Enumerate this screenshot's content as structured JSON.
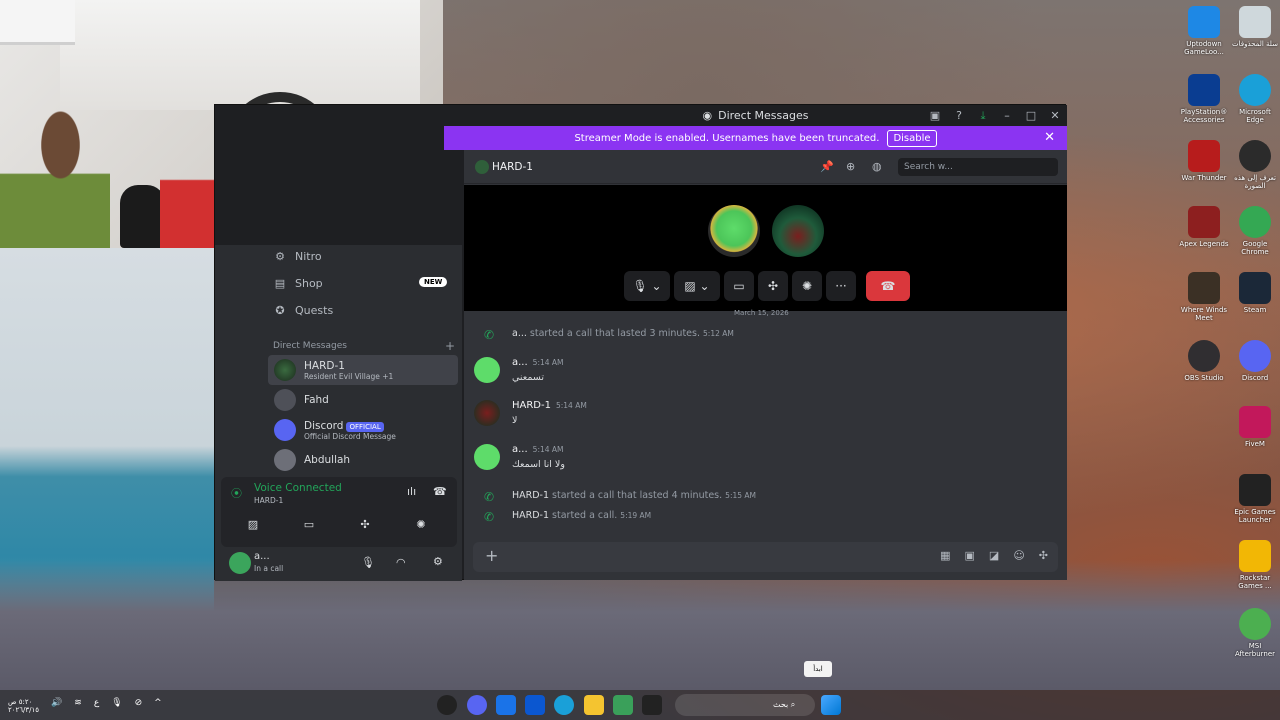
{
  "window": {
    "title": "Direct Messages",
    "banner_text": "Streamer Mode is enabled. Usernames have been truncated.",
    "banner_button": "Disable"
  },
  "sidebar": {
    "nav": [
      {
        "label": "Nitro",
        "icon": "nitro-icon"
      },
      {
        "label": "Shop",
        "icon": "shop-icon",
        "badge": "NEW"
      },
      {
        "label": "Quests",
        "icon": "quests-icon"
      }
    ],
    "dm_header": "Direct Messages",
    "dms": [
      {
        "name": "HARD-1",
        "sub": "Resident Evil Village +1"
      },
      {
        "name": "Fahd",
        "sub": ""
      },
      {
        "name": "Discord",
        "badge": "OFFICIAL",
        "sub": "Official Discord Message"
      },
      {
        "name": "Abdullah",
        "sub": ""
      }
    ]
  },
  "voice": {
    "status": "Voice Connected",
    "channel": "HARD-1"
  },
  "user": {
    "name": "a...",
    "status": "In a call"
  },
  "chat": {
    "header_name": "HARD-1",
    "search_placeholder": "Search w...",
    "date_divider": "March 15, 2026",
    "messages": [
      {
        "type": "system",
        "author": "a...",
        "text": " started a call that lasted 3 minutes.",
        "time": "5:12 AM"
      },
      {
        "type": "chat",
        "author": "a...",
        "time": "5:14 AM",
        "content": "تسمعني"
      },
      {
        "type": "chat",
        "author": "HARD-1",
        "time": "5:14 AM",
        "content": "لا"
      },
      {
        "type": "chat",
        "author": "a...",
        "time": "5:14 AM",
        "content": "ولا انا اسمعك"
      },
      {
        "type": "system",
        "author": "HARD-1",
        "text": " started a call that lasted 4 minutes.",
        "time": "5:15 AM"
      },
      {
        "type": "system",
        "author": "HARD-1",
        "text": " started a call.",
        "time": "5:19 AM"
      }
    ]
  },
  "desktop_icons": [
    {
      "label": "Uptodown GameLoo...",
      "color": "#1e88e5"
    },
    {
      "label": "سلة المحذوفات",
      "color": "#cfd8dc"
    },
    {
      "label": "PlayStation® Accessories",
      "color": "#0a3d91"
    },
    {
      "label": "Microsoft Edge",
      "color": "#1aa0d8"
    },
    {
      "label": "War Thunder",
      "color": "#b71c1c"
    },
    {
      "label": "تعرف إلى هذه الصورة",
      "color": "#2b2b2b"
    },
    {
      "label": "Apex Legends",
      "color": "#8d1f1f"
    },
    {
      "label": "Google Chrome",
      "color": "#34a853"
    },
    {
      "label": "Where Winds Meet",
      "color": "#3b3025"
    },
    {
      "label": "Steam",
      "color": "#1b2838"
    },
    {
      "label": "OBS Studio",
      "color": "#302e31"
    },
    {
      "label": "Discord",
      "color": "#5865f2"
    },
    {
      "label": "FiveM",
      "color": "#c2185b"
    },
    {
      "label": "Epic Games Launcher",
      "color": "#222222"
    },
    {
      "label": "Rockstar Games ...",
      "color": "#f2b705"
    },
    {
      "label": "MSI Afterburner",
      "color": "#4caf50"
    }
  ],
  "taskbar": {
    "clock_time": "٥:٢٠ ص",
    "clock_date": "٢٠٢٦/٣/١٥",
    "search_text": "بحث",
    "tooltip": "ابدأ"
  }
}
